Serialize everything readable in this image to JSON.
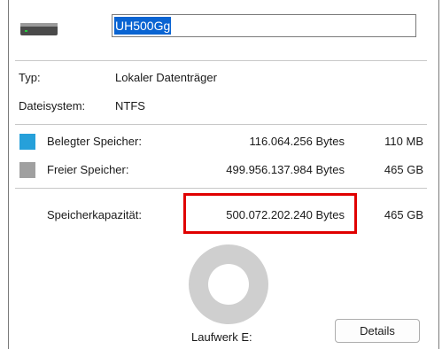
{
  "header": {
    "drive_icon": "hard-drive-icon",
    "name_value": "UH500Gg"
  },
  "info": {
    "type_label": "Typ:",
    "type_value": "Lokaler Datenträger",
    "fs_label": "Dateisystem:",
    "fs_value": "NTFS"
  },
  "usage": {
    "used": {
      "label": "Belegter Speicher:",
      "bytes": "116.064.256 Bytes",
      "size": "110 MB",
      "color": "#26a0da"
    },
    "free": {
      "label": "Freier Speicher:",
      "bytes": "499.956.137.984 Bytes",
      "size": "465 GB",
      "color": "#a0a0a0"
    },
    "capacity": {
      "label": "Speicherkapazität:",
      "bytes": "500.072.202.240 Bytes",
      "size": "465 GB"
    }
  },
  "footer": {
    "drive_label": "Laufwerk E:",
    "details_button": "Details"
  }
}
